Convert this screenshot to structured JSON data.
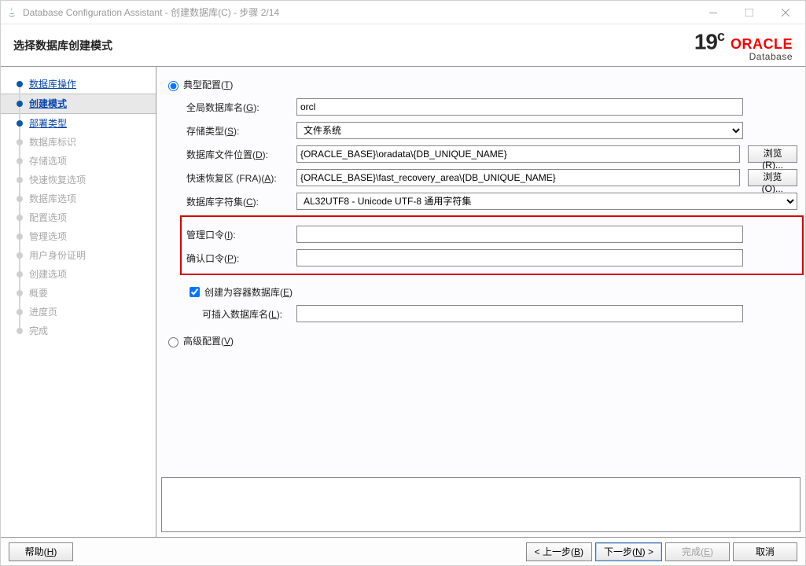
{
  "window": {
    "title": "Database Configuration Assistant - 创建数据库(C) - 步骤 2/14"
  },
  "header": {
    "page_title": "选择数据库创建模式",
    "logo_version": "19",
    "logo_version_suffix": "c",
    "logo_brand": "ORACLE",
    "logo_product": "Database"
  },
  "sidebar": {
    "steps": [
      {
        "label": "数据库操作",
        "link": true,
        "active_dot": true
      },
      {
        "label": "创建模式",
        "link": true,
        "active_dot": true,
        "current": true
      },
      {
        "label": "部署类型",
        "link": true,
        "active_dot": true
      },
      {
        "label": "数据库标识",
        "link": false
      },
      {
        "label": "存储选项",
        "link": false
      },
      {
        "label": "快速恢复选项",
        "link": false
      },
      {
        "label": "数据库选项",
        "link": false
      },
      {
        "label": "配置选项",
        "link": false
      },
      {
        "label": "管理选项",
        "link": false
      },
      {
        "label": "用户身份证明",
        "link": false
      },
      {
        "label": "创建选项",
        "link": false
      },
      {
        "label": "概要",
        "link": false
      },
      {
        "label": "进度页",
        "link": false
      },
      {
        "label": "完成",
        "link": false
      }
    ]
  },
  "form": {
    "typical_label_pre": "典型配置(",
    "typical_mn": "T",
    "typical_label_post": ")",
    "advanced_label_pre": "高级配置(",
    "advanced_mn": "V",
    "advanced_label_post": ")",
    "global_db_label_pre": "全局数据库名(",
    "global_db_mn": "G",
    "global_db_label_post": "):",
    "global_db_value": "orcl",
    "storage_label_pre": "存储类型(",
    "storage_mn": "S",
    "storage_label_post": "):",
    "storage_value": "文件系统",
    "dbfile_label_pre": "数据库文件位置(",
    "dbfile_mn": "D",
    "dbfile_label_post": "):",
    "dbfile_value": "{ORACLE_BASE}\\oradata\\{DB_UNIQUE_NAME}",
    "dbfile_browse_pre": "浏览(",
    "dbfile_browse_mn": "R",
    "dbfile_browse_post": ")...",
    "fra_label_pre": "快速恢复区 (FRA)(",
    "fra_mn": "A",
    "fra_label_post": "):",
    "fra_value": "{ORACLE_BASE}\\fast_recovery_area\\{DB_UNIQUE_NAME}",
    "fra_browse_pre": "浏览(",
    "fra_browse_mn": "O",
    "fra_browse_post": ")...",
    "charset_label_pre": "数据库字符集(",
    "charset_mn": "C",
    "charset_label_post": "):",
    "charset_value": "AL32UTF8 - Unicode UTF-8 通用字符集",
    "admin_pw_label_pre": "管理口令(",
    "admin_pw_mn": "I",
    "admin_pw_label_post": "):",
    "confirm_pw_label_pre": "确认口令(",
    "confirm_pw_mn": "P",
    "confirm_pw_label_post": "):",
    "cdb_label_pre": "创建为容器数据库(",
    "cdb_mn": "E",
    "cdb_label_post": ")",
    "pdb_label_pre": "可插入数据库名(",
    "pdb_mn": "L",
    "pdb_label_post": "):"
  },
  "footer": {
    "help_pre": "帮助(",
    "help_mn": "H",
    "help_post": ")",
    "back_pre": "< 上一步(",
    "back_mn": "B",
    "back_post": ")",
    "next_pre": "下一步(",
    "next_mn": "N",
    "next_post": ") >",
    "finish_pre": "完成(",
    "finish_mn": "E",
    "finish_post": ")",
    "cancel": "取消"
  }
}
